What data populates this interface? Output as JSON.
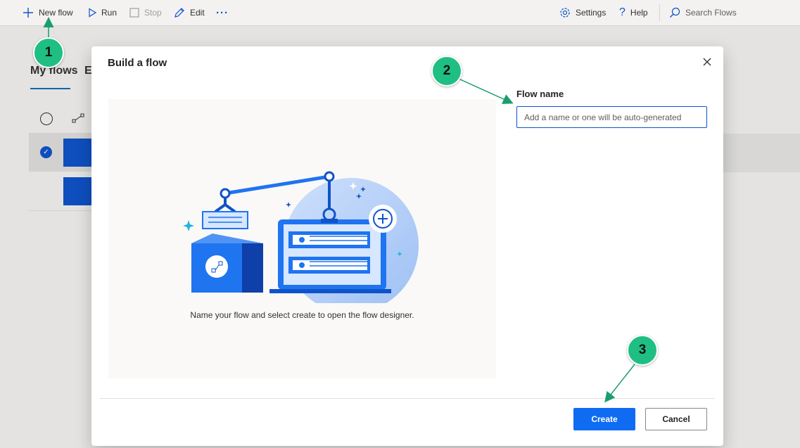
{
  "toolbar": {
    "new_flow": "New flow",
    "run": "Run",
    "stop": "Stop",
    "edit": "Edit",
    "more": "···",
    "settings": "Settings",
    "help": "Help",
    "search": "Search Flows"
  },
  "background": {
    "tab_my_flows": "My flows",
    "tab_examples_partial": "Ex"
  },
  "dialog": {
    "title": "Build a flow",
    "caption": "Name your flow and select create to open the flow designer.",
    "flow_name_label": "Flow name",
    "flow_name_placeholder": "Add a name or one will be auto-generated",
    "flow_name_value": "",
    "create_label": "Create",
    "cancel_label": "Cancel"
  },
  "callouts": [
    "1",
    "2",
    "3"
  ],
  "colors": {
    "accent": "#0f6cf2",
    "callout": "#1fbf84",
    "tile": "#0f53c9"
  },
  "icons": [
    "plus-icon",
    "play-icon",
    "stop-icon",
    "edit-icon",
    "more-icon",
    "settings-icon",
    "help-icon",
    "search-icon",
    "close-icon",
    "flow-icon",
    "desktop-icon"
  ]
}
